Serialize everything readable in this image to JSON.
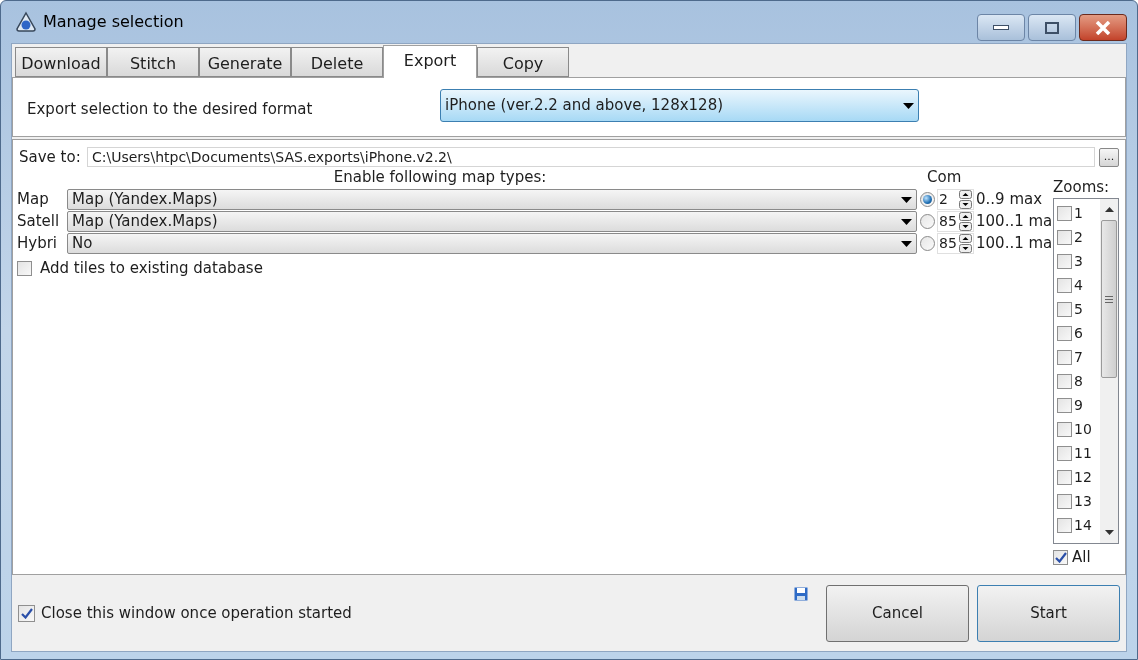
{
  "window": {
    "title": "Manage selection"
  },
  "tabs": [
    {
      "label": "Download",
      "selected": false
    },
    {
      "label": "Stitch",
      "selected": false
    },
    {
      "label": "Generate",
      "selected": false
    },
    {
      "label": "Delete",
      "selected": false
    },
    {
      "label": "Export",
      "selected": true
    },
    {
      "label": "Copy",
      "selected": false
    }
  ],
  "export": {
    "description": "Export selection to the desired format",
    "format": "iPhone (ver.2.2 and above, 128x128)"
  },
  "save_to": {
    "label": "Save to:",
    "value": "C:\\Users\\htpc\\Documents\\SAS.exports\\iPhone.v2.2\\",
    "browse": "..."
  },
  "map_types": {
    "heading": "Enable following map types:",
    "compression_heading": "Com",
    "rows": [
      {
        "label": "Map",
        "value": "Map (Yandex.Maps)",
        "selected": true,
        "compression": "2",
        "range": "0..9 max"
      },
      {
        "label": "Satell",
        "value": "Map (Yandex.Maps)",
        "selected": false,
        "compression": "85",
        "range": "100..1 ma"
      },
      {
        "label": "Hybri",
        "value": "No",
        "selected": false,
        "compression": "85",
        "range": "100..1 ma"
      }
    ]
  },
  "add_tiles": {
    "label": "Add tiles to existing database",
    "checked": false
  },
  "zooms": {
    "heading": "Zooms:",
    "items": [
      {
        "label": "1",
        "checked": false
      },
      {
        "label": "2",
        "checked": false
      },
      {
        "label": "3",
        "checked": false
      },
      {
        "label": "4",
        "checked": false
      },
      {
        "label": "5",
        "checked": false
      },
      {
        "label": "6",
        "checked": false
      },
      {
        "label": "7",
        "checked": false
      },
      {
        "label": "8",
        "checked": false
      },
      {
        "label": "9",
        "checked": false
      },
      {
        "label": "10",
        "checked": false
      },
      {
        "label": "11",
        "checked": false
      },
      {
        "label": "12",
        "checked": false
      },
      {
        "label": "13",
        "checked": false
      },
      {
        "label": "14",
        "checked": false
      }
    ],
    "all": {
      "label": "All",
      "checked": true
    }
  },
  "close_on_start": {
    "label": "Close this window once operation started",
    "checked": true
  },
  "buttons": [
    {
      "label": "Cancel",
      "kind": "normal"
    },
    {
      "label": "Start",
      "kind": "default"
    }
  ]
}
